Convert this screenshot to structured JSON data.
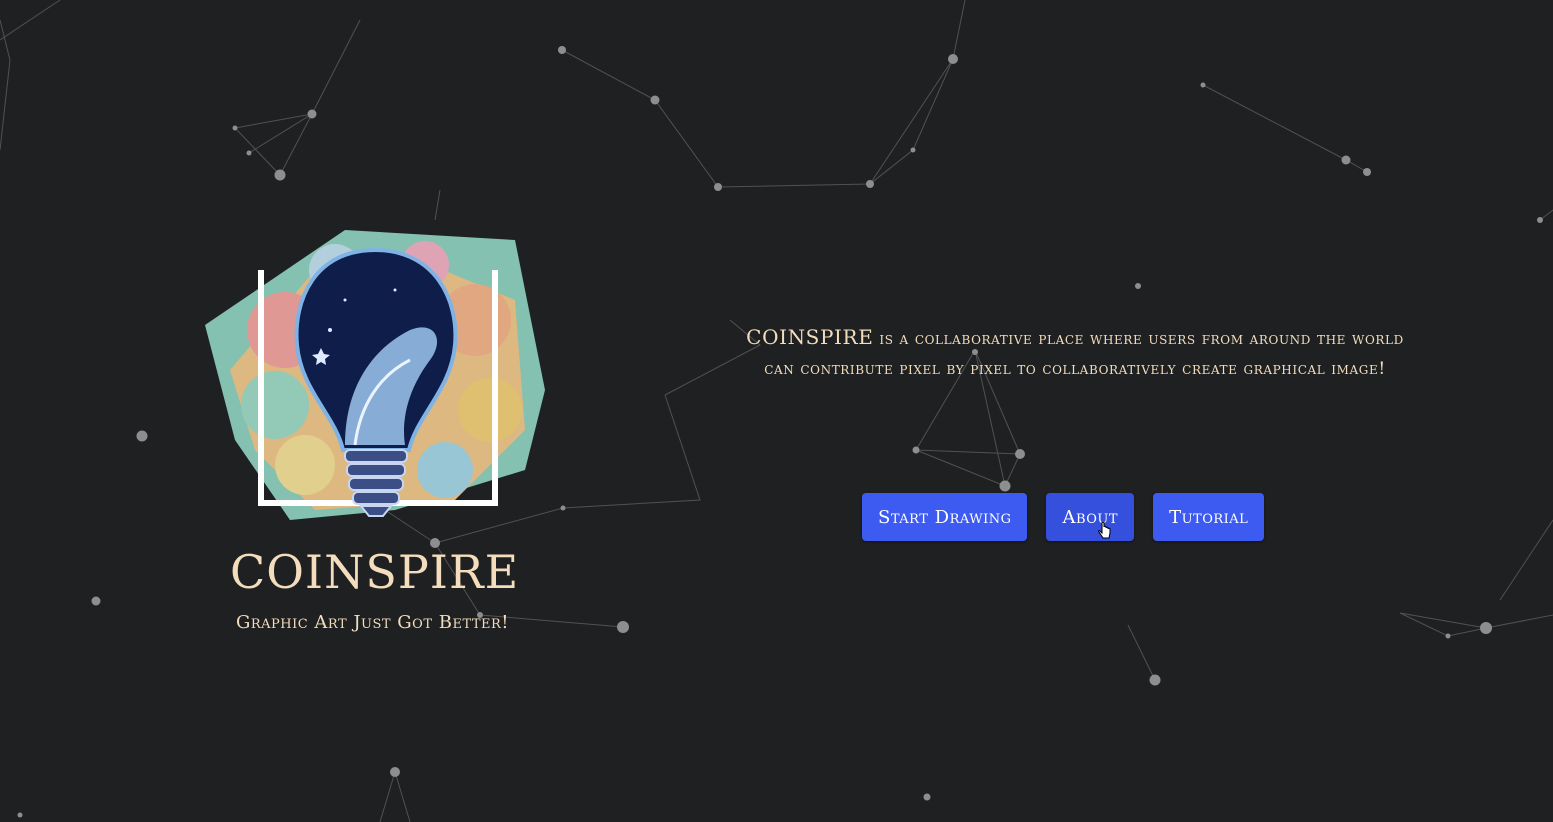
{
  "brand": {
    "logo_name": "lightbulb-wave-logo",
    "title": "COINSPIRE",
    "tagline": "Graphic Art Just Got Better!"
  },
  "description": {
    "brand": "COINSPIRE",
    "text": " is a collaborative place where users from around the world can contribute pixel by pixel to collaboratively create graphical image!"
  },
  "buttons": {
    "start": "Start Drawing",
    "about": "About",
    "tutorial": "Tutorial"
  },
  "colors": {
    "background": "#1f2022",
    "text": "#f3ddbc",
    "button": "#3d5af1",
    "network": "#8a8a8a"
  }
}
